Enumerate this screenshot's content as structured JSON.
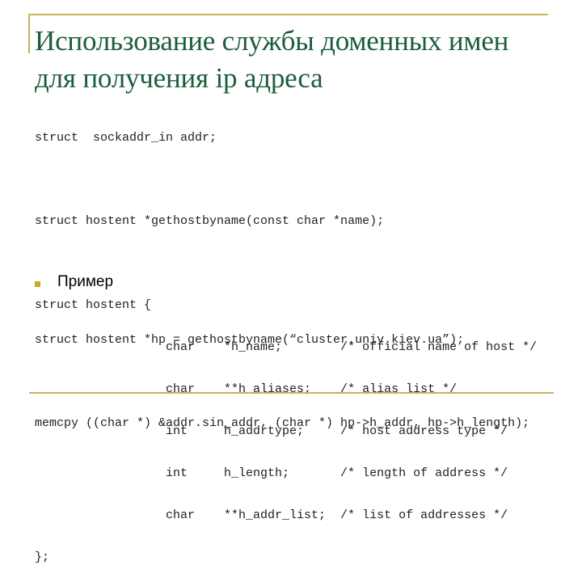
{
  "slide": {
    "title_lines": [
      "Использование службы доменных имен",
      "для получения ip адреса"
    ],
    "code_block_1": [
      "struct  sockaddr_in addr;",
      "",
      "struct hostent *gethostbyname(const char *name);",
      "",
      "struct hostent {",
      "                  char    *h_name;        /* official name of host */",
      "                  char    **h_aliases;    /* alias list */",
      "                  int     h_addrtype;     /* host address type */",
      "                  int     h_length;       /* length of address */",
      "                  char    **h_addr_list;  /* list of addresses */",
      "};"
    ],
    "bullet": {
      "icon": "square-bullet-icon",
      "text": "Пример"
    },
    "code_block_2": [
      "struct hostent *hp = gethostbyname(“cluster.univ.kiev.ua”);",
      "",
      "memcpy ((char *) &addr.sin_addr, (char *) hp->h_addr, hp->h_length);"
    ],
    "colors": {
      "title": "#1b5e3b",
      "rule": "#c9b25a",
      "bullet": "#c9a82a",
      "code": "#222222"
    }
  }
}
